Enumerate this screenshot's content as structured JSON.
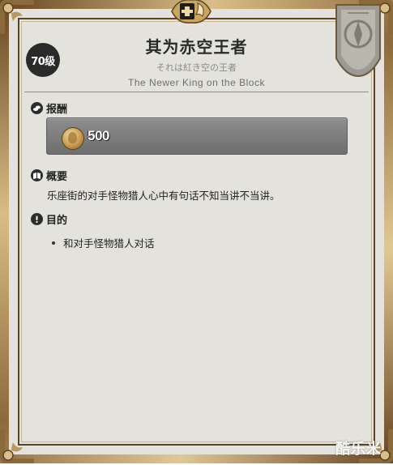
{
  "quest": {
    "level": "70级",
    "title": "其为赤空王者",
    "title_jp": "それは紅き空の王者",
    "title_en": "The Newer King on the Block"
  },
  "sections": {
    "reward": {
      "heading": "报酬",
      "gil_amount": "500",
      "icon": "coins-icon",
      "reward_icon": "gil-coin-icon"
    },
    "summary": {
      "heading": "概要",
      "text": "乐座街的对手怪物猎人心中有句话不知当讲不当讲。",
      "icon": "book-icon"
    },
    "objective": {
      "heading": "目的",
      "items": [
        "和对手怪物猎人对话"
      ],
      "icon": "exclamation-icon"
    }
  },
  "watermark": "酷乐米",
  "colors": {
    "frame": "#a58456",
    "background": "#e3e2dc",
    "reward_box": "#7d7d7d",
    "badge": "#2a2a2a"
  }
}
